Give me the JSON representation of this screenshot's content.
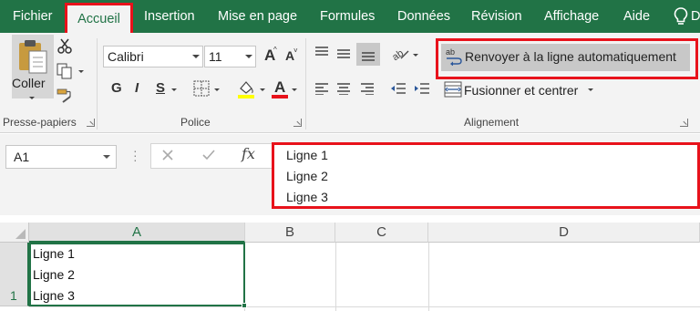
{
  "menu": {
    "items": [
      "Fichier",
      "Accueil",
      "Insertion",
      "Mise en page",
      "Formules",
      "Données",
      "Révision",
      "Affichage",
      "Aide"
    ],
    "active": "Accueil",
    "tell_me_icon": "lightbulb-icon",
    "tell_me_partial": "D"
  },
  "ribbon": {
    "clipboard": {
      "label": "Presse-papiers",
      "paste_label": "Coller",
      "icons": [
        "paste-icon",
        "cut-icon",
        "copy-icon",
        "format-painter-icon"
      ]
    },
    "font": {
      "label": "Police",
      "font_name": "Calibri",
      "font_size": "11",
      "bold": "G",
      "italic": "I",
      "underline": "S",
      "grow_label": "A",
      "shrink_label": "A",
      "font_color_label": "A",
      "highlight_color": "#ffff00",
      "font_color": "#e8121b"
    },
    "alignment": {
      "label": "Alignement",
      "wrap_text_label": "Renvoyer à la ligne automatiquement",
      "merge_label": "Fusionner et centrer",
      "wrap_icon_text": "ab"
    }
  },
  "formula_bar": {
    "name_box": "A1",
    "fx_label": "fx",
    "lines": [
      "Ligne 1",
      "Ligne 2",
      "Ligne 3"
    ]
  },
  "sheet": {
    "columns": [
      "A",
      "B",
      "C",
      "D"
    ],
    "selected_column": "A",
    "row_number": "1",
    "cell_a1_lines": [
      "Ligne 1",
      "Ligne 2",
      "Ligne 3"
    ]
  },
  "colors": {
    "excel_green": "#217346",
    "highlight_red": "#e8121b",
    "ribbon_bg": "#f3f3f3"
  }
}
